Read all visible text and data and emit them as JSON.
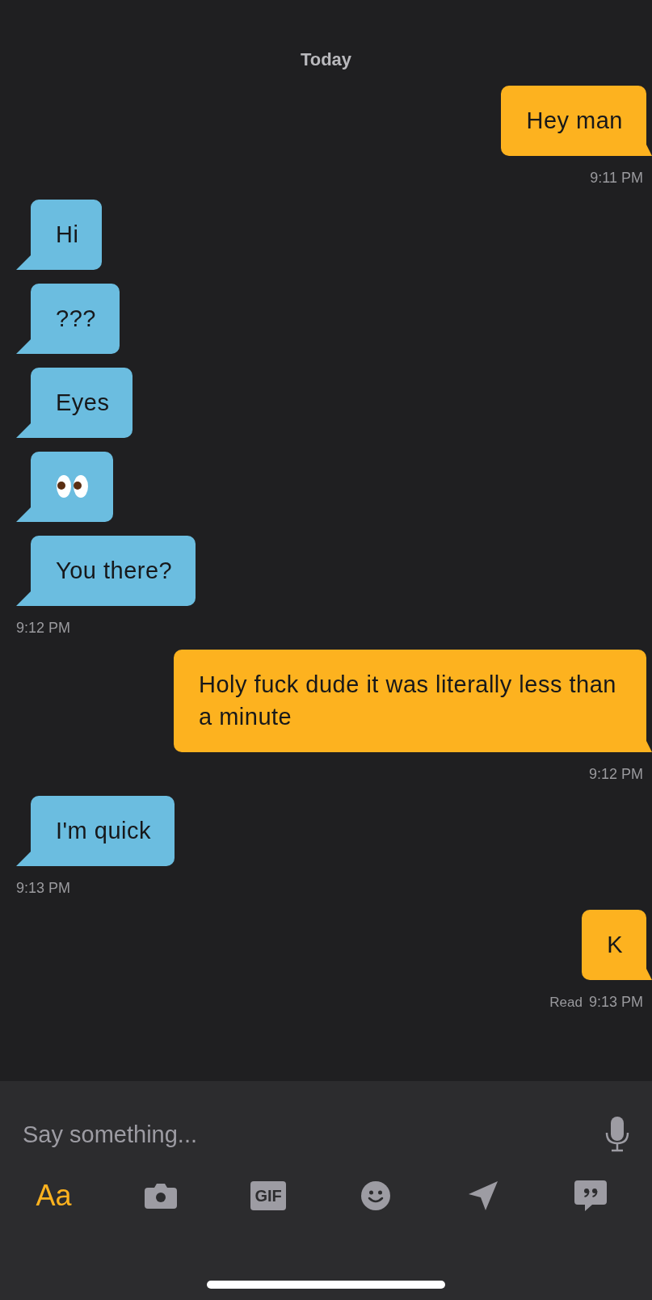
{
  "date_header": "Today",
  "messages": [
    {
      "kind": "bubble",
      "outgoing": true,
      "text": "Hey man"
    },
    {
      "kind": "time",
      "text": "9:11 PM"
    },
    {
      "kind": "bubble",
      "outgoing": false,
      "text": "Hi"
    },
    {
      "kind": "bubble",
      "outgoing": false,
      "text": "???"
    },
    {
      "kind": "bubble",
      "outgoing": false,
      "text": "Eyes"
    },
    {
      "kind": "eyes",
      "outgoing": false
    },
    {
      "kind": "bubble",
      "outgoing": false,
      "text": "You there?"
    },
    {
      "kind": "time",
      "text": "9:12 PM"
    },
    {
      "kind": "bubble",
      "outgoing": true,
      "text": "Holy fuck dude it was literally less than a minute"
    },
    {
      "kind": "time",
      "text": "9:12 PM"
    },
    {
      "kind": "bubble",
      "outgoing": false,
      "text": "I'm quick"
    },
    {
      "kind": "time",
      "text": "9:13 PM"
    },
    {
      "kind": "bubble",
      "outgoing": true,
      "text": "K"
    },
    {
      "kind": "time",
      "status": "Read",
      "text": "9:13 PM"
    }
  ],
  "composer": {
    "placeholder": "Say something..."
  },
  "toolbar": [
    {
      "kind": "text",
      "label": "Aa",
      "selected": true
    },
    {
      "kind": "camera",
      "selected": false
    },
    {
      "kind": "gif",
      "label": "GIF",
      "selected": false
    },
    {
      "kind": "smiley",
      "selected": false
    },
    {
      "kind": "location",
      "selected": false
    },
    {
      "kind": "phrases",
      "selected": false
    }
  ]
}
